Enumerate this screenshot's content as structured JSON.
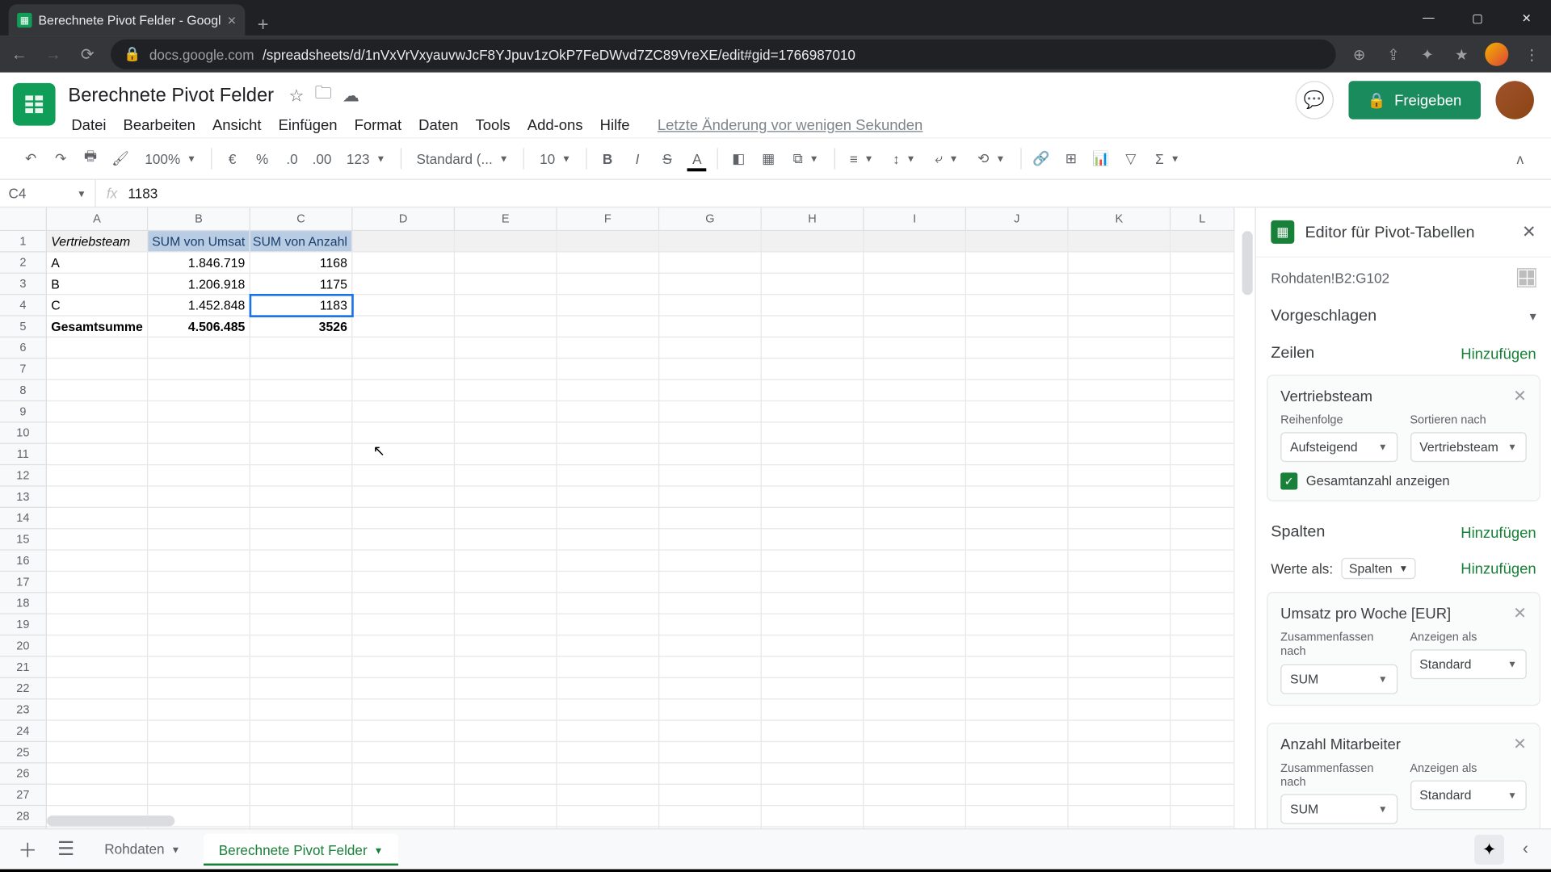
{
  "browser": {
    "tab_title": "Berechnete Pivot Felder - Googl",
    "url_host": "docs.google.com",
    "url_path": "/spreadsheets/d/1nVxVrVxyauvwJcF8YJpuv1zOkP7FeDWvd7ZC89VreXE/edit#gid=1766987010"
  },
  "doc": {
    "title": "Berechnete Pivot Felder",
    "menus": [
      "Datei",
      "Bearbeiten",
      "Ansicht",
      "Einfügen",
      "Format",
      "Daten",
      "Tools",
      "Add-ons",
      "Hilfe"
    ],
    "history": "Letzte Änderung vor wenigen Sekunden",
    "share": "Freigeben"
  },
  "toolbar": {
    "zoom": "100%",
    "currency": "€",
    "percent": "%",
    "dec_dec": ".0",
    "dec_inc": ".00",
    "numfmt": "123",
    "font": "Standard (...",
    "size": "10"
  },
  "formula": {
    "ref": "C4",
    "value": "1183"
  },
  "columns": [
    "A",
    "B",
    "C",
    "D",
    "E",
    "F",
    "G",
    "H",
    "I",
    "J",
    "K",
    "L"
  ],
  "sheet": {
    "header": {
      "A": "Vertriebsteam",
      "B": "SUM von Umsat",
      "C": "SUM von Anzahl"
    },
    "rows": [
      {
        "A": "A",
        "B": "1.846.719",
        "C": "1168"
      },
      {
        "A": "B",
        "B": "1.206.918",
        "C": "1175"
      },
      {
        "A": "C",
        "B": "1.452.848",
        "C": "1183"
      }
    ],
    "total": {
      "A": "Gesamtsumme",
      "B": "4.506.485",
      "C": "3526"
    }
  },
  "pivot": {
    "title": "Editor für Pivot-Tabellen",
    "range": "Rohdaten!B2:G102",
    "suggested": "Vorgeschlagen",
    "rows_label": "Zeilen",
    "cols_label": "Spalten",
    "values_label": "Werte als:",
    "values_as": "Spalten",
    "add": "Hinzufügen",
    "order_label": "Reihenfolge",
    "sortby_label": "Sortieren nach",
    "summarize_label": "Zusammenfassen nach",
    "showas_label": "Anzeigen als",
    "row_card": {
      "name": "Vertriebsteam",
      "order": "Aufsteigend",
      "sortby": "Vertriebsteam",
      "showtotal": "Gesamtanzahl anzeigen"
    },
    "val1": {
      "name": "Umsatz pro Woche [EUR]",
      "summarize": "SUM",
      "showas": "Standard"
    },
    "val2": {
      "name": "Anzahl Mitarbeiter",
      "summarize": "SUM",
      "showas": "Standard"
    }
  },
  "tabs": {
    "t1": "Rohdaten",
    "t2": "Berechnete Pivot Felder"
  }
}
